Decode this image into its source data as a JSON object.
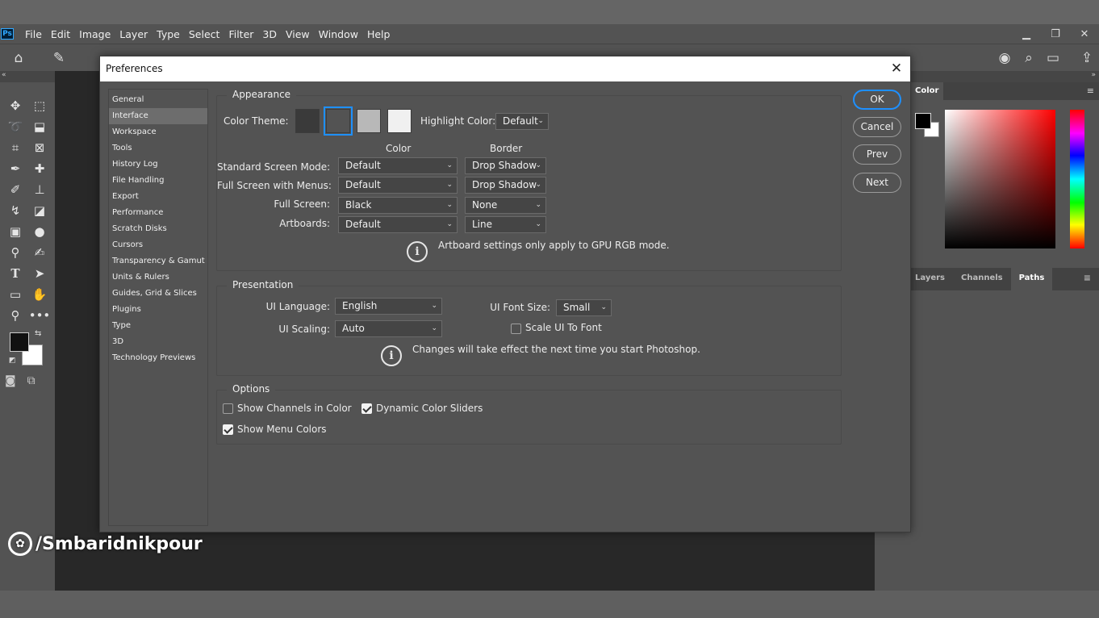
{
  "app": {
    "logo": "Ps",
    "menu": [
      "File",
      "Edit",
      "Image",
      "Layer",
      "Type",
      "Select",
      "Filter",
      "3D",
      "View",
      "Window",
      "Help"
    ],
    "window_controls": [
      "minimize-icon",
      "restore-icon",
      "close-icon"
    ]
  },
  "toolbar": {
    "tools": [
      "move-icon",
      "marquee-icon",
      "lasso-icon",
      "object-select-icon",
      "crop-icon",
      "frame-icon",
      "eyedropper-icon",
      "healing-icon",
      "brush-icon",
      "stamp-icon",
      "history-brush-icon",
      "eraser-icon",
      "gradient-icon",
      "blur-icon",
      "dodge-icon",
      "pen-icon",
      "type-icon",
      "path-select-icon",
      "rectangle-icon",
      "hand-icon",
      "zoom-icon",
      "more-icon"
    ],
    "foreground_color": "#111111",
    "background_color": "#ffffff"
  },
  "color_panel": {
    "tab": "Color",
    "hue": "#ff0000"
  },
  "layers_panel": {
    "tabs": [
      "Layers",
      "Channels",
      "Paths"
    ],
    "active_tab": "Paths"
  },
  "dialog": {
    "title": "Preferences",
    "categories": [
      "General",
      "Interface",
      "Workspace",
      "Tools",
      "History Log",
      "File Handling",
      "Export",
      "Performance",
      "Scratch Disks",
      "Cursors",
      "Transparency & Gamut",
      "Units & Rulers",
      "Guides, Grid & Slices",
      "Plugins",
      "Type",
      "3D",
      "Technology Previews"
    ],
    "selected_category": "Interface",
    "appearance": {
      "title": "Appearance",
      "color_theme_label": "Color Theme:",
      "themes": [
        "#3a3a3a",
        "#535353",
        "#b8b8b8",
        "#f0f0f0"
      ],
      "selected_theme_index": 1,
      "highlight_label": "Highlight Color:",
      "highlight_value": "Default",
      "col_color": "Color",
      "col_border": "Border",
      "rows": [
        {
          "label": "Standard Screen Mode:",
          "color": "Default",
          "border": "Drop Shadow"
        },
        {
          "label": "Full Screen with Menus:",
          "color": "Default",
          "border": "Drop Shadow"
        },
        {
          "label": "Full Screen:",
          "color": "Black",
          "border": "None"
        },
        {
          "label": "Artboards:",
          "color": "Default",
          "border": "Line"
        }
      ],
      "info": "Artboard settings only apply to GPU RGB mode."
    },
    "presentation": {
      "title": "Presentation",
      "language_label": "UI Language:",
      "language_value": "English",
      "font_size_label": "UI Font Size:",
      "font_size_value": "Small",
      "scaling_label": "UI Scaling:",
      "scaling_value": "Auto",
      "scale_font_label": "Scale UI To Font",
      "scale_font_checked": false,
      "info": "Changes will take effect the next time you start Photoshop."
    },
    "options": {
      "title": "Options",
      "show_channels_label": "Show Channels in Color",
      "show_channels_checked": false,
      "dynamic_sliders_label": "Dynamic Color Sliders",
      "dynamic_sliders_checked": true,
      "show_menu_colors_label": "Show Menu Colors",
      "show_menu_colors_checked": true
    },
    "buttons": {
      "ok": "OK",
      "cancel": "Cancel",
      "prev": "Prev",
      "next": "Next"
    }
  },
  "watermark": "/Smbaridnikpour"
}
